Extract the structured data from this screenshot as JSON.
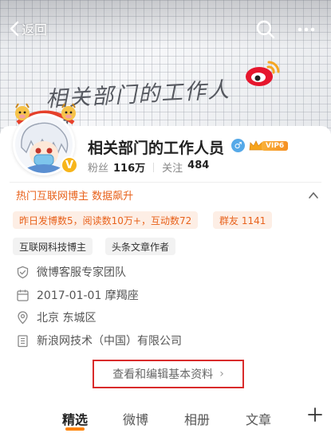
{
  "header": {
    "back_label": "返回",
    "banner_handwriting": "相关部门的工作人员",
    "icons": [
      "back-chevron-icon",
      "search-icon",
      "more-icon",
      "weibo-logo-icon"
    ]
  },
  "profile": {
    "name": "相关部门的工作人员",
    "gender_symbol": "♂",
    "vip_level": "VIP6",
    "verified_badge": "V",
    "fans_label": "粉丝",
    "fans_value": "116万",
    "following_label": "关注",
    "following_value": "484"
  },
  "highlights": {
    "hot_text": "热门互联网博主 数据飙升",
    "yesterday_stats": "昨日发博数5，阅读数10万+，互动数72",
    "group_chat": "群友 1141"
  },
  "tags": [
    "互联网科技博主",
    "头条文章作者"
  ],
  "info": {
    "verified": "微博客服专家团队",
    "birthday": "2017-01-01 摩羯座",
    "location": "北京 东城区",
    "company": "新浪网技术（中国）有限公司"
  },
  "edit_button": {
    "label": "查看和编辑基本资料",
    "arrow": "›"
  },
  "tabs": [
    "精选",
    "微博",
    "相册",
    "文章"
  ],
  "active_tab_index": 0,
  "colors": {
    "accent": "#ff8200",
    "hot_orange": "#e8621c",
    "highlight_border": "#d92b2b",
    "vip_gold": "#f7b51b"
  }
}
